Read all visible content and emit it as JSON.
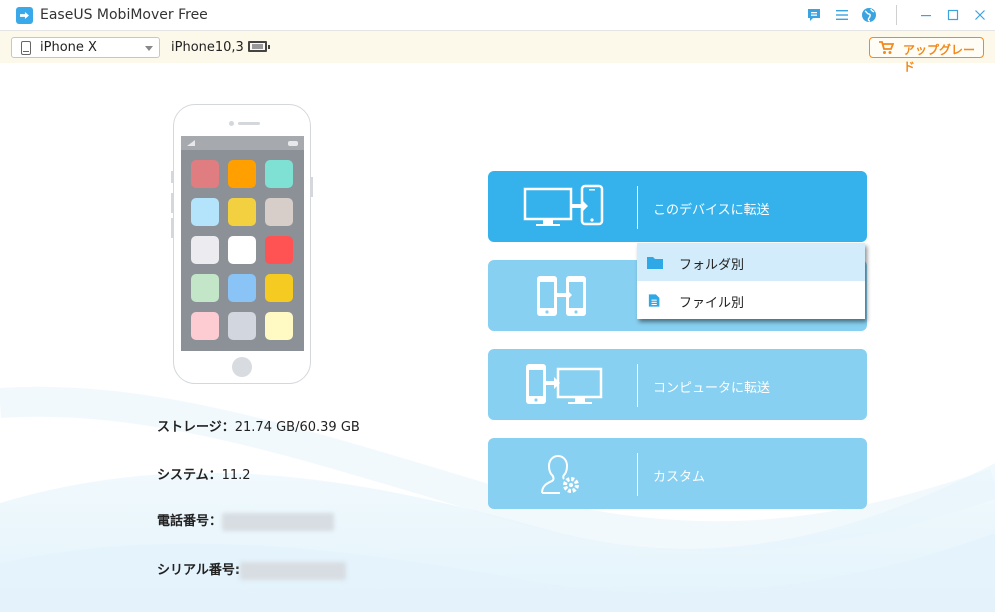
{
  "window": {
    "title": "EaseUS MobiMover Free",
    "controls": [
      "feedback-icon",
      "menu-icon",
      "globe-icon",
      "minimize-icon",
      "maximize-icon",
      "close-icon"
    ]
  },
  "devicebar": {
    "selected_device": "iPhone X",
    "model": "iPhone10,3",
    "battery_icon": "battery-icon",
    "upgrade_label": "アップグレード",
    "upgrade_icon": "cart-icon"
  },
  "phone_illustration": {
    "app_colors": [
      "#e07d80",
      "#ffa000",
      "#7fe0d4",
      "#b3e4fb",
      "#f2d03f",
      "#d7cdc9",
      "#ececf0",
      "#ffffff",
      "#ff5252",
      "#c3e6c8",
      "#8ac3f5",
      "#f5cb22",
      "#fdccd2",
      "#d2d6de",
      "#fff9c4"
    ]
  },
  "device_info": {
    "storage_label": "ストレージ：",
    "storage_value": "21.74 GB/60.39 GB",
    "system_label": "システム：",
    "system_value": "11.2",
    "phone_label": "電話番号：",
    "serial_label": "シリアル番号:"
  },
  "actions": [
    {
      "label": "このデバイスに転送",
      "icon": "computer-to-phone-icon",
      "active": true
    },
    {
      "label": "",
      "icon": "phone-to-phone-icon",
      "active": false
    },
    {
      "label": "コンピュータに転送",
      "icon": "phone-to-computer-icon",
      "active": false
    },
    {
      "label": "カスタム",
      "icon": "user-gear-icon",
      "active": false
    }
  ],
  "dropdown": {
    "items": [
      {
        "label": "フォルダ別",
        "icon": "folder-icon",
        "highlighted": true
      },
      {
        "label": "ファイル別",
        "icon": "file-icon",
        "highlighted": false
      }
    ]
  },
  "colors": {
    "accent": "#35b1ec",
    "card_inactive": "#87d0f1",
    "upgrade": "#f08a1e",
    "devicebar_bg": "#fcf8ea",
    "dropdown_highlight": "#d2ecfb"
  }
}
